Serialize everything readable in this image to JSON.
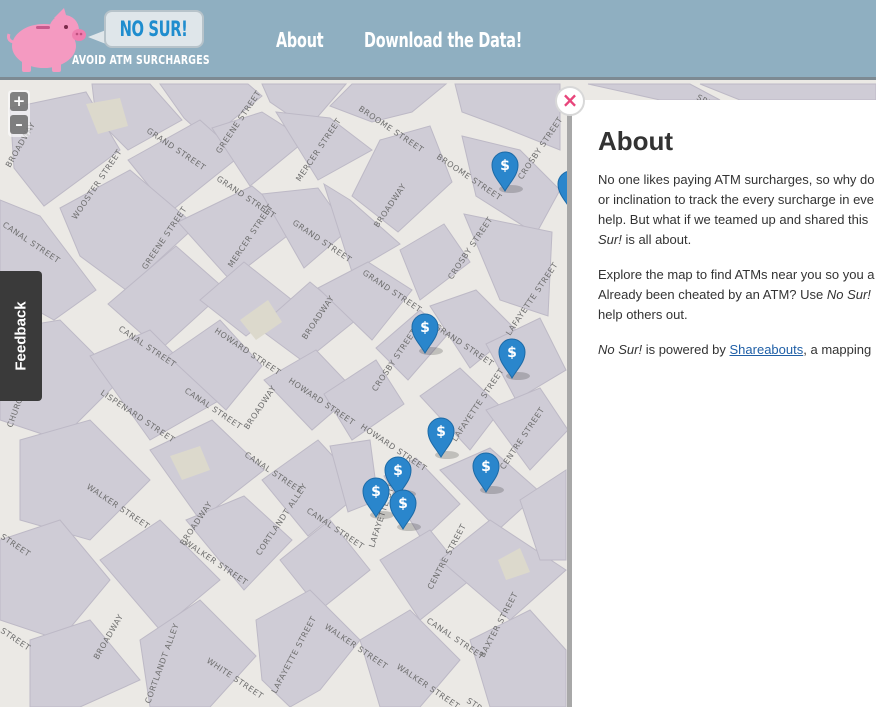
{
  "header": {
    "brand_name": "NO SUR!",
    "tagline": "AVOID ATM SURCHARGES",
    "nav": [
      {
        "label": "About"
      },
      {
        "label": "Download the Data!"
      }
    ]
  },
  "map": {
    "zoom_in_label": "+",
    "zoom_out_label": "–",
    "marker_symbol": "$",
    "marker_color": "#2a86cc",
    "streets": [
      {
        "label": "GRAND STREET"
      },
      {
        "label": "GREENE STREET"
      },
      {
        "label": "BROOME STREET"
      },
      {
        "label": "BROOME STREET"
      },
      {
        "label": "CROSBY STREET"
      },
      {
        "label": "MERCER STREET"
      },
      {
        "label": "WOOSTER STREET"
      },
      {
        "label": "GRAND STREET"
      },
      {
        "label": "BROADWAY"
      },
      {
        "label": "GRAND STREET"
      },
      {
        "label": "GREENE STREET"
      },
      {
        "label": "MERCER STREET"
      },
      {
        "label": "GRAND STREET"
      },
      {
        "label": "CROSBY STREET"
      },
      {
        "label": "BROADWAY"
      },
      {
        "label": "GRAND STREET"
      },
      {
        "label": "LAFAYETTE STREET"
      },
      {
        "label": "HOWARD STREET"
      },
      {
        "label": "CANAL STREET"
      },
      {
        "label": "HOWARD STREET"
      },
      {
        "label": "CROSBY STREET"
      },
      {
        "label": "LISPENARD STREET"
      },
      {
        "label": "CANAL STREET"
      },
      {
        "label": "BROADWAY"
      },
      {
        "label": "HOWARD STREET"
      },
      {
        "label": "LAFAYETTE STREET"
      },
      {
        "label": "CENTRE STREET"
      },
      {
        "label": "WALKER STREET"
      },
      {
        "label": "CANAL STREET"
      },
      {
        "label": "BROADWAY"
      },
      {
        "label": "CORTLANDT ALLEY"
      },
      {
        "label": "CANAL STREET"
      },
      {
        "label": "LAFAYETTE STREET"
      },
      {
        "label": "WALKER STREET"
      },
      {
        "label": "CENTRE STREET"
      },
      {
        "label": "BROADWAY"
      },
      {
        "label": "WHITE STREET"
      },
      {
        "label": "LAFAYETTE STREET"
      },
      {
        "label": "WALKER STREET"
      },
      {
        "label": "CANAL STREET"
      },
      {
        "label": "BAXTER STREET"
      },
      {
        "label": "WALKER STREET"
      },
      {
        "label": "CORTLANDT ALLEY"
      },
      {
        "label": "CHURCH STREET"
      },
      {
        "label": "BROADWAY"
      },
      {
        "label": "CANAL STREET"
      },
      {
        "label": "STREET"
      },
      {
        "label": "STREET"
      },
      {
        "label": "STREET"
      },
      {
        "label": "SPRING"
      }
    ]
  },
  "feedback_label": "Feedback",
  "about_panel": {
    "close_label": "×",
    "title": "About",
    "p1": {
      "line1": "No one likes paying ATM surcharges, so why do",
      "line2": "or inclination to track the every surcharge in eve",
      "line3": "help. But what if we teamed up and shared this",
      "line4_em": "Sur!",
      "line4_rest": " is all about."
    },
    "p2": {
      "line1": "Explore the map to find ATMs near you so you a",
      "line2_pre": "Already been cheated by an ATM? Use ",
      "line2_em": "No Sur!",
      "line3": "help others out."
    },
    "p3": {
      "em": "No Sur!",
      "pre": " is powered by ",
      "link": "Shareabouts",
      "post": ", a mapping"
    }
  }
}
